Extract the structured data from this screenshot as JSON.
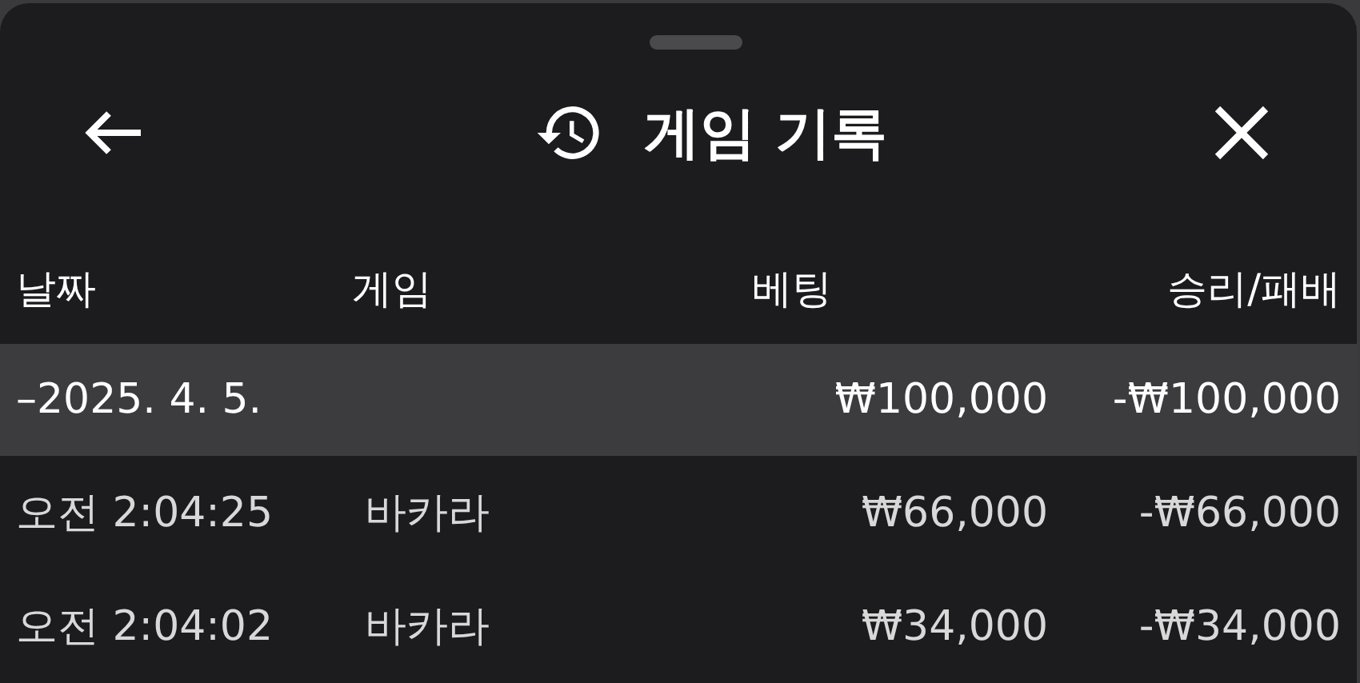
{
  "header": {
    "title": "게임 기록"
  },
  "table": {
    "columns": [
      "날짜",
      "게임",
      "베팅",
      "승리/패배"
    ],
    "groups": [
      {
        "date": "–2025. 4. 5.",
        "expanded": true,
        "bet": "₩100,000",
        "result": "-₩100,000",
        "rows": [
          {
            "time": "오전 2:04:25",
            "game": "바카라",
            "bet": "₩66,000",
            "result": "-₩66,000"
          },
          {
            "time": "오전 2:04:02",
            "game": "바카라",
            "bet": "₩34,000",
            "result": "-₩34,000"
          }
        ]
      }
    ]
  }
}
